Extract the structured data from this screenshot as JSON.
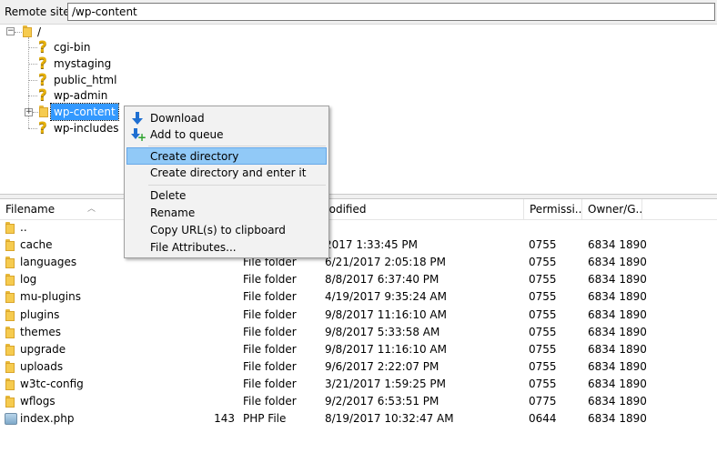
{
  "remote_site": {
    "label": "Remote site:",
    "path": "/wp-content"
  },
  "tree": {
    "root": "/",
    "items": [
      {
        "name": "cgi-bin",
        "icon": "unknown-folder-icon"
      },
      {
        "name": "mystaging",
        "icon": "unknown-folder-icon"
      },
      {
        "name": "public_html",
        "icon": "unknown-folder-icon"
      },
      {
        "name": "wp-admin",
        "icon": "unknown-folder-icon"
      },
      {
        "name": "wp-content",
        "icon": "folder-icon",
        "selected": true
      },
      {
        "name": "wp-includes",
        "icon": "unknown-folder-icon"
      }
    ]
  },
  "list": {
    "columns": {
      "filename": "Filename",
      "filesize": "",
      "filetype": "",
      "modified": "nodified",
      "permissions": "Permissi...",
      "owner": "Owner/G..."
    },
    "rows": [
      {
        "name": "..",
        "size": "",
        "type": "",
        "modified": "",
        "perm": "",
        "owner": ""
      },
      {
        "name": "cache",
        "size": "",
        "type": "",
        "modified": "2017 1:33:45 PM",
        "perm": "0755",
        "owner": "6834 1890"
      },
      {
        "name": "languages",
        "size": "",
        "type": "File folder",
        "modified": "6/21/2017 2:05:18 PM",
        "perm": "0755",
        "owner": "6834 1890"
      },
      {
        "name": "log",
        "size": "",
        "type": "File folder",
        "modified": "8/8/2017 6:37:40 PM",
        "perm": "0755",
        "owner": "6834 1890"
      },
      {
        "name": "mu-plugins",
        "size": "",
        "type": "File folder",
        "modified": "4/19/2017 9:35:24 AM",
        "perm": "0755",
        "owner": "6834 1890"
      },
      {
        "name": "plugins",
        "size": "",
        "type": "File folder",
        "modified": "9/8/2017 11:16:10 AM",
        "perm": "0755",
        "owner": "6834 1890"
      },
      {
        "name": "themes",
        "size": "",
        "type": "File folder",
        "modified": "9/8/2017 5:33:58 AM",
        "perm": "0755",
        "owner": "6834 1890"
      },
      {
        "name": "upgrade",
        "size": "",
        "type": "File folder",
        "modified": "9/8/2017 11:16:10 AM",
        "perm": "0755",
        "owner": "6834 1890"
      },
      {
        "name": "uploads",
        "size": "",
        "type": "File folder",
        "modified": "9/6/2017 2:22:07 PM",
        "perm": "0755",
        "owner": "6834 1890"
      },
      {
        "name": "w3tc-config",
        "size": "",
        "type": "File folder",
        "modified": "3/21/2017 1:59:25 PM",
        "perm": "0755",
        "owner": "6834 1890"
      },
      {
        "name": "wflogs",
        "size": "",
        "type": "File folder",
        "modified": "9/2/2017 6:53:51 PM",
        "perm": "0775",
        "owner": "6834 1890"
      },
      {
        "name": "index.php",
        "size": "143",
        "type": "PHP File",
        "modified": "8/19/2017 10:32:47 AM",
        "perm": "0644",
        "owner": "6834 1890"
      }
    ]
  },
  "context_menu": {
    "download": "Download",
    "add_to_queue": "Add to queue",
    "create_directory": "Create directory",
    "create_directory_enter": "Create directory and enter it",
    "delete": "Delete",
    "rename": "Rename",
    "copy_url": "Copy URL(s) to clipboard",
    "file_attributes": "File Attributes..."
  },
  "colors": {
    "selection": "#3399ff",
    "menu_highlight": "#91c9f7",
    "folder": "#f6cb4f"
  }
}
